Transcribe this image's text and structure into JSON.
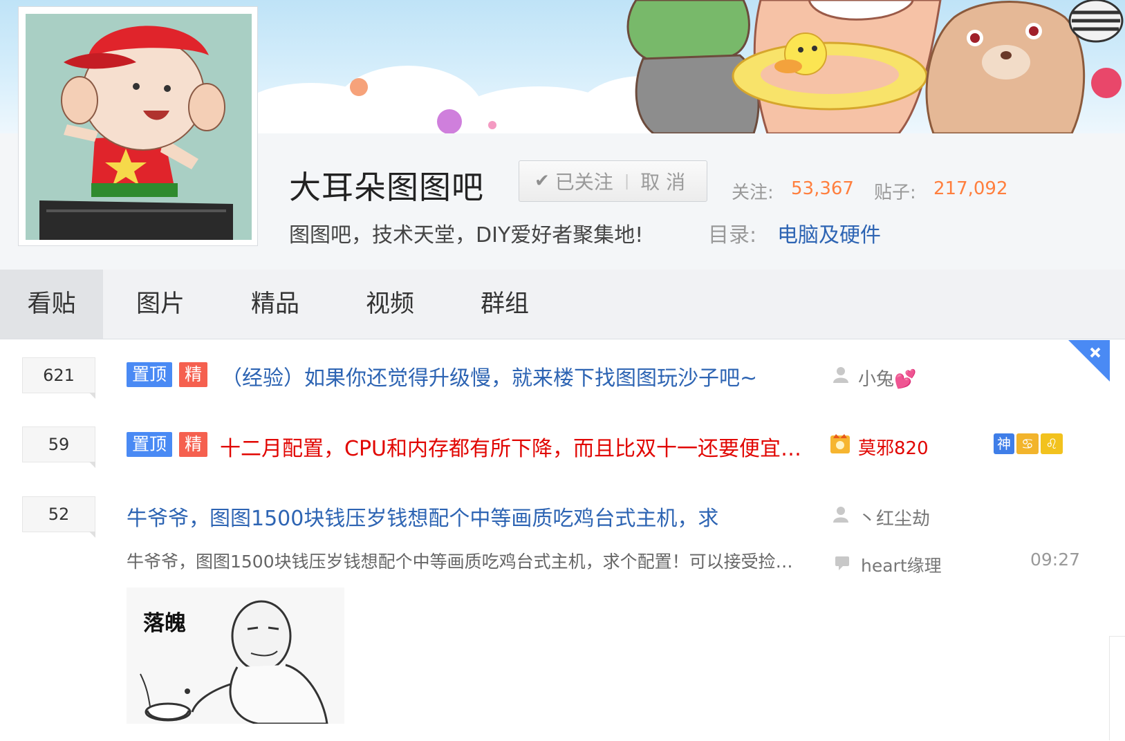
{
  "header": {
    "forum_name": "大耳朵图图吧",
    "follow_button": {
      "followed_label": "已关注",
      "cancel_label": "取 消"
    },
    "stats": {
      "follow_label": "关注:",
      "follow_count": "53,367",
      "posts_label": "贴子:",
      "posts_count": "217,092"
    },
    "slogan": "图图吧，技术天堂，DIY爱好者聚集地!",
    "directory_label": "目录:",
    "directory_value": "电脑及硬件"
  },
  "tabs": [
    {
      "label": "看贴",
      "active": true
    },
    {
      "label": "图片",
      "active": false
    },
    {
      "label": "精品",
      "active": false
    },
    {
      "label": "视频",
      "active": false
    },
    {
      "label": "群组",
      "active": false
    }
  ],
  "threads": [
    {
      "reply_count": "621",
      "badges": [
        "置顶",
        "精"
      ],
      "title": "（经验）如果你还觉得升级慢，就来楼下找图图玩沙子吧~",
      "author": "小兔💕"
    },
    {
      "reply_count": "59",
      "badges": [
        "置顶",
        "精"
      ],
      "title": "十二月配置，CPU和内存都有所下降，而且比双十一还要便宜…",
      "author": "莫邪820",
      "level_icons": [
        "神",
        "",
        ""
      ]
    },
    {
      "reply_count": "52",
      "title": "牛爷爷，图图1500块钱压岁钱想配个中等画质吃鸡台式主机，求",
      "author": "丶红尘劫",
      "abstract": "牛爷爷，图图1500块钱压岁钱想配个中等画质吃鸡台式主机，求个配置！可以接受捡…",
      "last_reply_user": "heart缘理",
      "last_reply_time": "09:27",
      "image_text": "落魄"
    }
  ],
  "colors": {
    "link_blue": "#2d64b3",
    "stat_orange": "#ff7f3e",
    "top_badge": "#4a8af4",
    "good_badge": "#f5604f",
    "hot_red": "#e10602"
  }
}
